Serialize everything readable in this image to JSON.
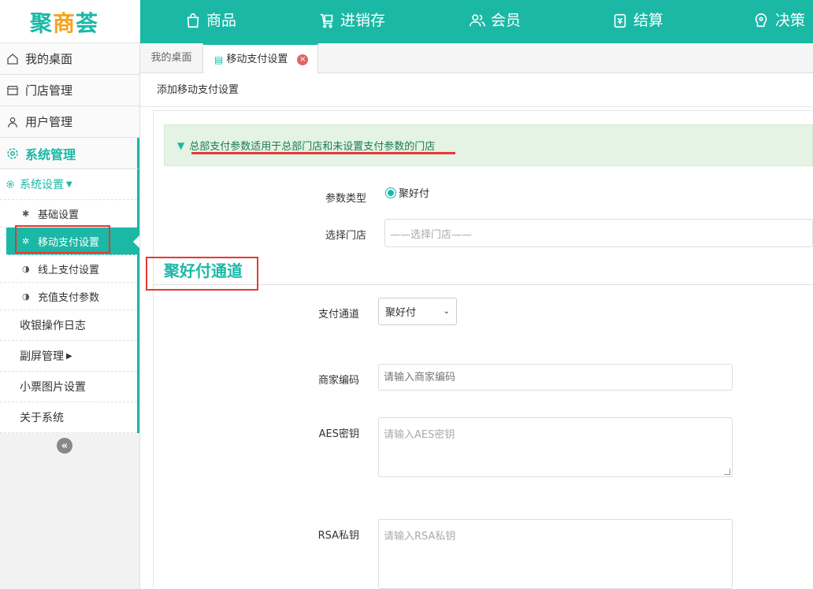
{
  "brand": {
    "logo_main": "聚",
    "logo_accent": "商",
    "logo_tail": "荟"
  },
  "topnav": {
    "items": [
      {
        "label": "商品",
        "icon": "shopping-bag-icon"
      },
      {
        "label": "进销存",
        "icon": "inventory-icon"
      },
      {
        "label": "会员",
        "icon": "members-icon"
      },
      {
        "label": "结算",
        "icon": "settlement-icon"
      },
      {
        "label": "决策",
        "icon": "decision-icon"
      }
    ]
  },
  "sidebar": {
    "items": [
      {
        "label": "我的桌面",
        "icon": "home-icon"
      },
      {
        "label": "门店管理",
        "icon": "store-icon"
      },
      {
        "label": "用户管理",
        "icon": "user-icon"
      },
      {
        "label": "系统管理",
        "icon": "gear-icon"
      }
    ],
    "submenu_head": "系统设置",
    "subitems": [
      {
        "label": "基础设置",
        "icon": "gear-icon"
      },
      {
        "label": "移动支付设置",
        "icon": "gears-icon"
      },
      {
        "label": "线上支付设置",
        "icon": "half-circle-icon"
      },
      {
        "label": "充值支付参数",
        "icon": "half-circle-icon"
      }
    ],
    "plain_items": [
      {
        "label": "收银操作日志"
      },
      {
        "label": "副屏管理"
      },
      {
        "label": "小票图片设置"
      },
      {
        "label": "关于系统"
      }
    ],
    "collapse_glyph": "«"
  },
  "tabs": {
    "home": "我的桌面",
    "current": "移动支付设置",
    "close": "×"
  },
  "breadcrumb": "添加移动支付设置",
  "notice": "总部支付参数适用于总部门店和未设置支付参数的门店",
  "form": {
    "param_type_label": "参数类型",
    "param_type_value": "聚好付",
    "store_label": "选择门店",
    "store_placeholder": "——选择门店——",
    "section_title": "聚好付通道",
    "channel_label": "支付通道",
    "channel_value": "聚好付",
    "merchant_label": "商家编码",
    "merchant_placeholder": "请输入商家编码",
    "aes_label": "AES密钥",
    "aes_placeholder": "请输入AES密钥",
    "rsa_label": "RSA私钥",
    "rsa_placeholder": "请输入RSA私钥"
  },
  "colors": {
    "accent": "#1bb8a6",
    "logo_accent": "#f7a21b",
    "highlight": "#e53935"
  }
}
